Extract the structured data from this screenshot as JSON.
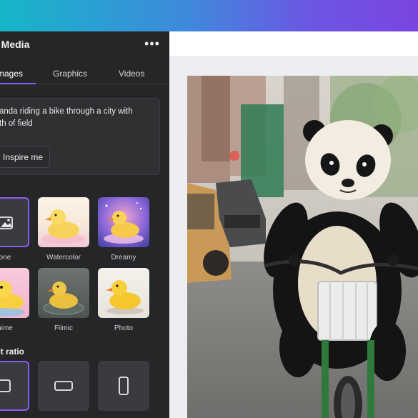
{
  "panel": {
    "title": "c Media",
    "more": "•••",
    "tabs": [
      {
        "label": "mages",
        "active": true
      },
      {
        "label": "Graphics",
        "active": false
      },
      {
        "label": "Videos",
        "active": false
      }
    ],
    "prompt": "anda riding a bike through a city with\nth of field",
    "inspire_button": "Inspire me",
    "styles_label": "s",
    "styles": [
      {
        "label": "one",
        "icon": "image-icon",
        "selected": true
      },
      {
        "label": "Watercolor",
        "selected": false
      },
      {
        "label": "Dreamy",
        "selected": false
      },
      {
        "label": "nime",
        "selected": false
      },
      {
        "label": "Filmic",
        "selected": false
      },
      {
        "label": "Photo",
        "selected": false
      }
    ],
    "aspect_label": "ct ratio",
    "aspect_ratios": [
      {
        "name": "square",
        "selected": true
      },
      {
        "name": "landscape",
        "selected": false
      },
      {
        "name": "portrait",
        "selected": false
      }
    ]
  },
  "colors": {
    "accent": "#8b5cf6",
    "panel_bg": "#252627",
    "topbar_start": "#16b6c9",
    "topbar_end": "#7a45e0"
  },
  "canvas": {
    "image": "panda-on-bicycle-photo"
  }
}
